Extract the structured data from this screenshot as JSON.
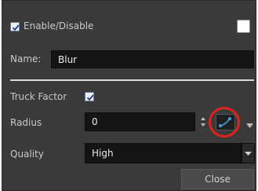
{
  "enable_disable": {
    "label": "Enable/Disable",
    "checked": true,
    "swatch_color": "#ffffff"
  },
  "name": {
    "label": "Name:",
    "value": "Blur"
  },
  "truck_factor": {
    "label": "Truck Factor",
    "checked": true
  },
  "radius": {
    "label": "Radius",
    "value": "0",
    "stepper_icon": "up-down-stepper-icon",
    "function_icon": "function-curve-icon",
    "menu_icon": "dropdown-arrow-icon",
    "highlight_color": "#e0211d"
  },
  "quality": {
    "label": "Quality",
    "value": "High",
    "options_icon": "dropdown-arrow-icon"
  },
  "close_button": {
    "label": "Close"
  }
}
